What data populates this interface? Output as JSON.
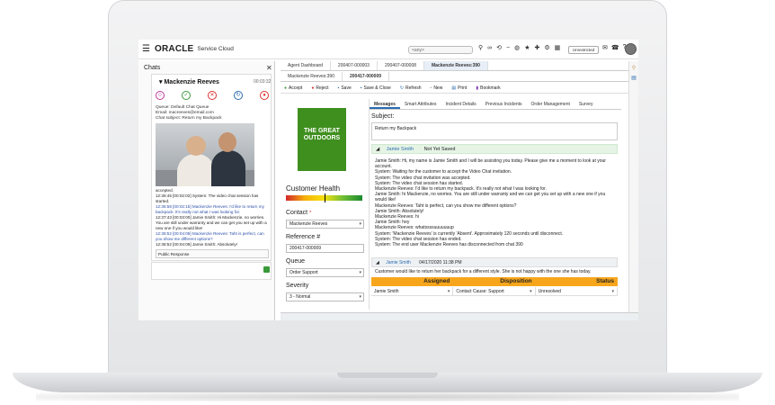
{
  "header": {
    "brand": "ORACLE",
    "product": "Service Cloud",
    "search_placeholder": "<any>",
    "unrestricted": "Unrestricted"
  },
  "chat_pane": {
    "title": "Chats",
    "customer": "Mackenzie Reeves",
    "timer": "00:03:32",
    "queue_lines": [
      "Queue: Default Chat Queue",
      "Email: macreeves@email.com",
      "Chat subject: Return my Backpack"
    ],
    "transcript": [
      {
        "text": "accepted.",
        "mine": false
      },
      {
        "text": "12:36:45 [00:02:02]  System: The video chat session has started.",
        "mine": false
      },
      {
        "text": "12:36:58 [00:02:15]  Mackenzie Reeves: I'd like to return my backpack. It's really not what I was looking for.",
        "mine": true
      },
      {
        "text": "12:37:43 [00:03:00]  Jamie Smith: Hi Mackenzie, no worries. You are still under warranty and we can get you set up with a new one if you would like!",
        "mine": false
      },
      {
        "text": "12:38:52 [00:04:09]  Mackenzie Reeves: Taht is perfect, can you show me different options?",
        "mine": true
      },
      {
        "text": "12:38:52 [00:04:09]  Jamie Smith: Absolutely!",
        "mine": false
      }
    ],
    "response_type": "Public Response"
  },
  "tabs_top": [
    "Agent Dashboard",
    "200407-000003",
    "200407-000008",
    "Mackenzie Reeves:390"
  ],
  "tabs_second": [
    "Mackenzie Reeves:390",
    "200417-000009"
  ],
  "toolbar": [
    "Accept",
    "Reject",
    "Save",
    "Save & Close",
    "Refresh",
    "New",
    "Print",
    "Bookmark"
  ],
  "left_form": {
    "logo_text": "THE GREAT OUTDOORS",
    "customer_health_label": "Customer Health",
    "customer_health_level": 0.5,
    "contact_label": "Contact",
    "contact_value": "Mackenzie Reeves",
    "reference_label": "Reference #",
    "reference_value": "200417-000009",
    "queue_label": "Queue",
    "queue_value": "Order Support",
    "severity_label": "Severity",
    "severity_value": "3 - Normal"
  },
  "right_tabs": [
    "Messages",
    "Smart Attributes",
    "Incident Details",
    "Previous Incidents",
    "Order Management",
    "Survey"
  ],
  "subject": {
    "label": "Subject:",
    "value": "Return my Backpack"
  },
  "message1": {
    "author": "Jamie Smith",
    "status": "Not Yet Saved",
    "lines": [
      "Jamie Smith: Hi, my name is Jamie Smith and I will be assisting you today. Please give me a moment to look at your account.",
      "System: Waiting for the customer to accept the Video Chat invitation.",
      "System: The video chat invitation was accepted.",
      "System: The video chat session has started.",
      "Mackenzie Reeves: I'd like to return my backpack. It's really not what I was looking for.",
      "Jamie Smith: hi Mackenzie, no worries. You are still under warranty and we can get you set up with a new one if you would like!",
      "Mackenzie Reeves: Taht is perfect, can you show me different options?",
      "Jamie Smith: Absolutely!",
      "Mackenzie Reeves: hi",
      "Jamie Smith: hey",
      "Mackenzie Reeves: whatssssuuuuuuup",
      "System: 'Mackenzie Reeves' is currently 'Absent'. Approximately 120 seconds until disconnect.",
      "System: The video chat session has ended.",
      "System: The end user Mackenzie Reeves has disconnected from chat 390"
    ]
  },
  "message2": {
    "author": "Jamie Smith",
    "date": "04/17/2020 11:38 PM",
    "body": "Customer would like to return her backpack for a different style. She is not happy with the one she has today."
  },
  "grid": {
    "headers": [
      "Assigned",
      "Disposition",
      "Status"
    ],
    "values": [
      "Jamie Smith",
      "Contact Cause: Support",
      "Unresolved"
    ]
  },
  "colors": {
    "accent": "#2b6cb0",
    "logo_green": "#3f8f1f",
    "grid_header": "#f7a61c"
  }
}
